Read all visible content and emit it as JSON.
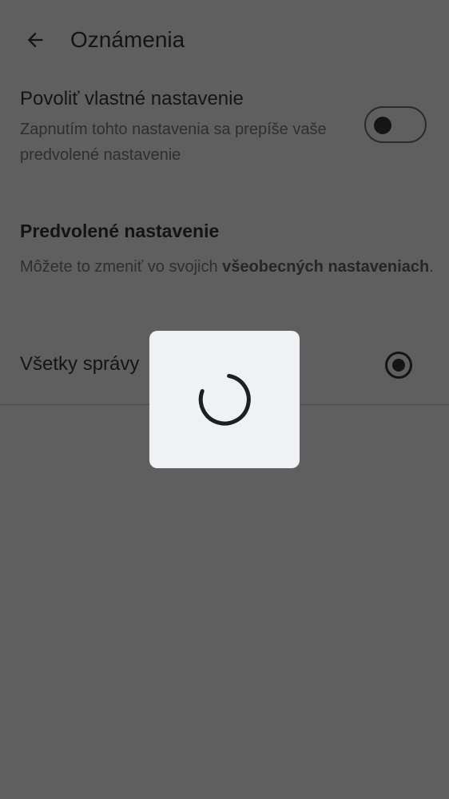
{
  "header": {
    "title": "Oznámenia",
    "back_icon": "arrow-back-icon"
  },
  "custom_setting": {
    "title": "Povoliť vlastné nastavenie",
    "description": "Zapnutím tohto nastavenia sa prepíše vaše predvolené nastavenie",
    "toggle_on": false
  },
  "default_section": {
    "title": "Predvolené nastavenie",
    "description_prefix": "Môžete to zmeniť vo svojich ",
    "description_link": "všeobecných nastaveniach",
    "description_suffix": "."
  },
  "options": [
    {
      "label": "Všetky správy",
      "selected": true
    }
  ],
  "overlay": {
    "type": "loading-dialog",
    "icon": "spinner-icon"
  },
  "colors": {
    "scrim": "#5f5f60",
    "dialog": "#f0f1f5",
    "text": "#141416"
  }
}
